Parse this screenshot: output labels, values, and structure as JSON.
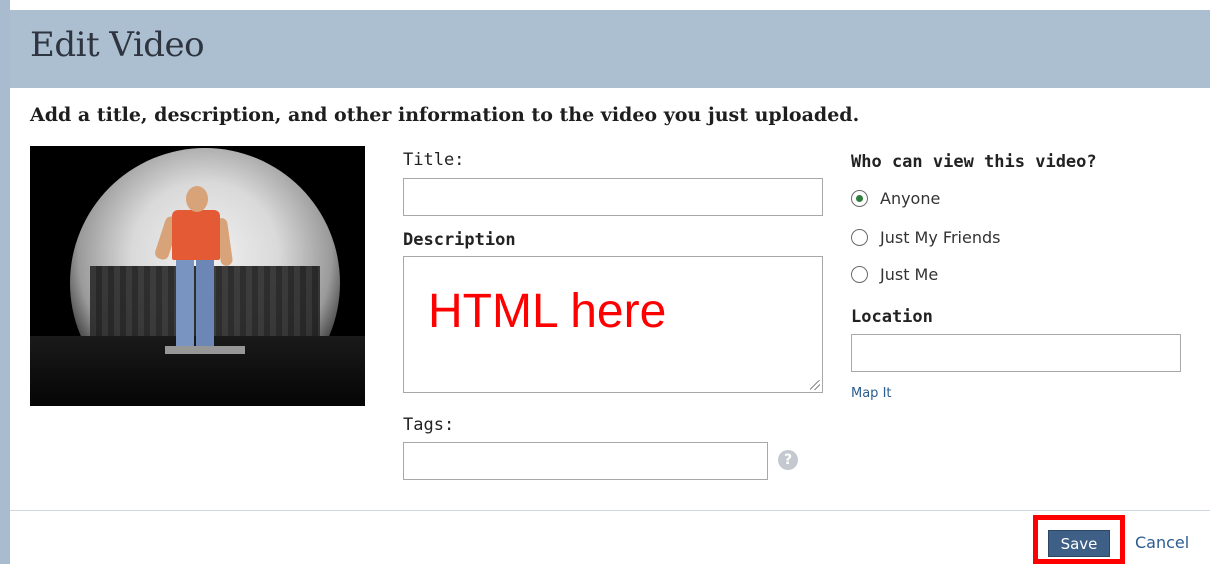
{
  "header": {
    "title": "Edit Video"
  },
  "intro": {
    "text": "Add a title, description, and other information to the video you just uploaded."
  },
  "form": {
    "title_label": "Title:",
    "title_value": "",
    "description_label": "Description",
    "description_value": "HTML here",
    "tags_label": "Tags:",
    "tags_value": "",
    "help_glyph": "?"
  },
  "privacy": {
    "heading": "Who can view this video?",
    "options": [
      {
        "label": "Anyone",
        "selected": true
      },
      {
        "label": "Just My Friends",
        "selected": false
      },
      {
        "label": "Just Me",
        "selected": false
      }
    ]
  },
  "location": {
    "label": "Location",
    "value": "",
    "map_link": "Map It"
  },
  "actions": {
    "save_label": "Save",
    "cancel_label": "Cancel"
  },
  "colors": {
    "header_bg": "#abbfd1",
    "save_bg": "#3e5f86",
    "highlight": "#ff0000",
    "link": "#2b5d8f"
  }
}
